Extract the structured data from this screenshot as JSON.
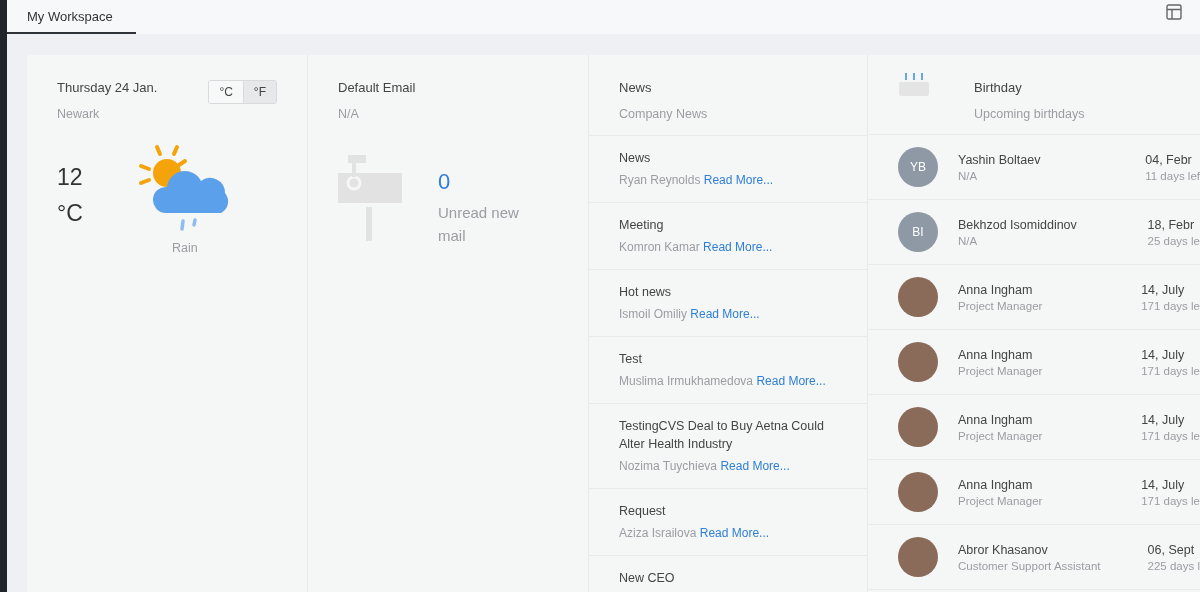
{
  "tabs": [
    {
      "label": "My Workspace",
      "selected": true
    }
  ],
  "weather": {
    "date": "Thursday 24 Jan.",
    "city": "Newark",
    "units": [
      {
        "label": "°C",
        "selected": false
      },
      {
        "label": "°F",
        "selected": true
      }
    ],
    "temperature": "12",
    "unit": "°C",
    "condition": "Rain"
  },
  "email": {
    "title": "Default Email",
    "account": "N/A",
    "count": "0",
    "caption": "Unread new mail"
  },
  "news": {
    "title": "News",
    "subtitle": "Company News",
    "items": [
      {
        "title": "News",
        "author": "Ryan Reynolds",
        "link": "Read More..."
      },
      {
        "title": "Meeting",
        "author": "Komron Kamar",
        "link": "Read More..."
      },
      {
        "title": "Hot news",
        "author": "Ismoil Omiliy",
        "link": "Read More..."
      },
      {
        "title": "Test",
        "author": "Muslima Irmukhamedova",
        "link": "Read More..."
      },
      {
        "title": "TestingCVS Deal to Buy Aetna Could Alter Health Industry",
        "author": "Nozima Tuychieva",
        "link": "Read More..."
      },
      {
        "title": "Request",
        "author": "Aziza Israilova",
        "link": "Read More..."
      },
      {
        "title": "New CEO"
      }
    ]
  },
  "birthdays": {
    "title": "Birthday",
    "subtitle": "Upcoming birthdays",
    "people": [
      {
        "kind": "initials",
        "initials": "YB",
        "name": "Yashin Boltaev",
        "role": "N/A",
        "date": "04, Febr",
        "days_left": "11 days lef"
      },
      {
        "kind": "initials",
        "initials": "BI",
        "name": "Bekhzod Isomiddinov",
        "role": "N/A",
        "date": "18, Febr",
        "days_left": "25 days le"
      },
      {
        "kind": "photo",
        "name": "Anna Ingham",
        "role": "Project Manager",
        "date": "14, July",
        "days_left": "171 days le"
      },
      {
        "kind": "photo",
        "name": "Anna Ingham",
        "role": "Project Manager",
        "date": "14, July",
        "days_left": "171 days le"
      },
      {
        "kind": "photo",
        "name": "Anna Ingham",
        "role": "Project Manager",
        "date": "14, July",
        "days_left": "171 days le"
      },
      {
        "kind": "photo",
        "name": "Anna Ingham",
        "role": "Project Manager",
        "date": "14, July",
        "days_left": "171 days le"
      },
      {
        "kind": "photo",
        "name": "Abror Khasanov",
        "role": "Customer Support Assistant",
        "date": "06, Sept",
        "days_left": "225 days l"
      }
    ]
  }
}
